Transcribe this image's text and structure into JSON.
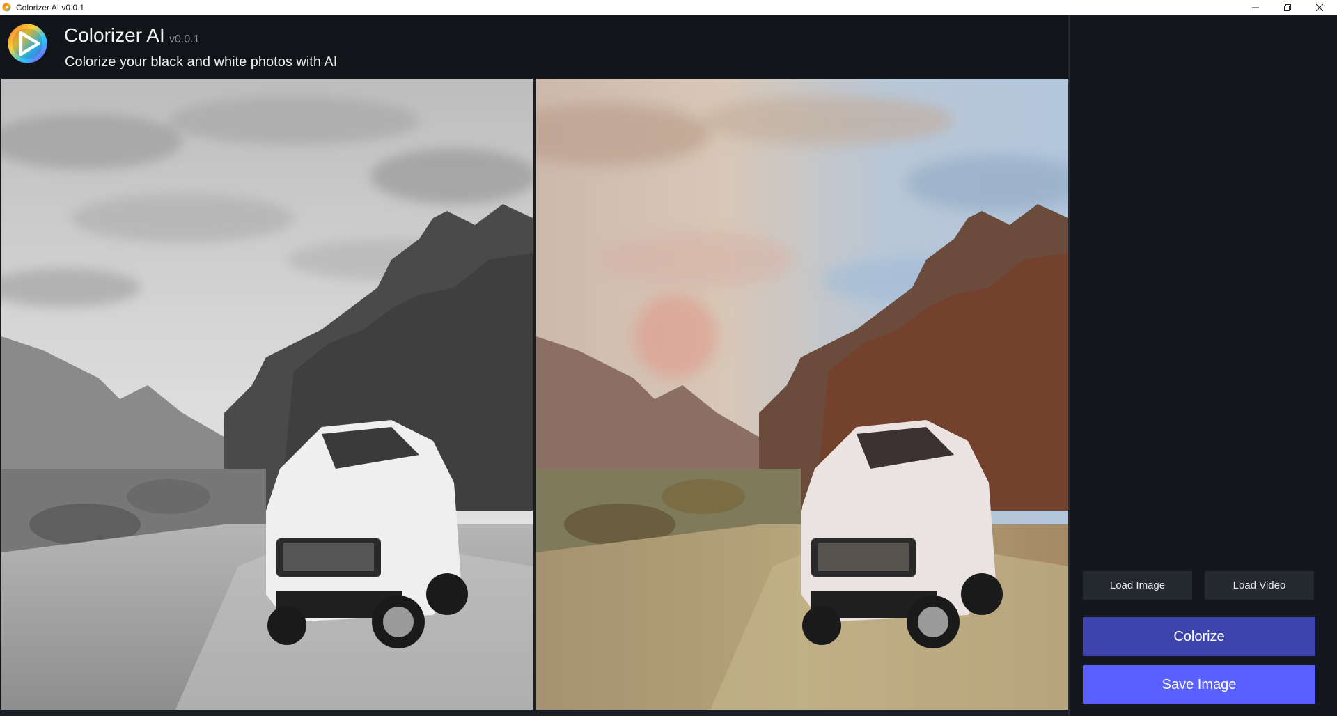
{
  "window": {
    "title": "Colorizer AI v0.0.1",
    "icon": "colorizer-app-icon",
    "controls": [
      "minimize-icon",
      "restore-icon",
      "close-icon"
    ]
  },
  "header": {
    "title": "Colorizer AI",
    "version": "v0.0.1",
    "subtitle": "Colorize your black and white photos with AI",
    "logo": "play-logo-icon"
  },
  "panels": {
    "original": "grayscale-photo",
    "colorized": "colorized-photo"
  },
  "sidebar": {
    "load_image": "Load Image",
    "load_video": "Load Video",
    "colorize": "Colorize",
    "save_image": "Save Image"
  },
  "colors": {
    "background": "#14171d",
    "header": "#111418",
    "colorize_button": "#3e44ad",
    "save_button": "#5a5fff",
    "small_button": "#252930"
  }
}
